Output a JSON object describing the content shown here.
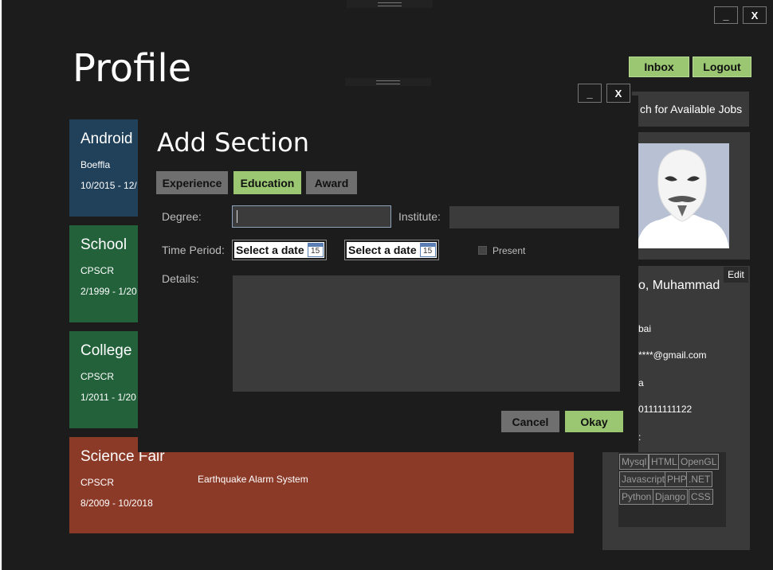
{
  "window": {
    "minimize_label": "_",
    "close_label": "X"
  },
  "page": {
    "title": "Profile"
  },
  "header": {
    "inbox_label": "Inbox",
    "logout_label": "Logout",
    "search_jobs_label": "ch for Available Jobs"
  },
  "sections": [
    {
      "title": "Android",
      "org": "Boeffla",
      "period": "10/2015 - 12/"
    },
    {
      "title": "School",
      "org": "CPSCR",
      "period": "2/1999 - 1/20"
    },
    {
      "title": "College",
      "org": "CPSCR",
      "period": "1/2011 - 1/20"
    },
    {
      "title": "Science Fair",
      "org": "CPSCR",
      "period": "8/2009 - 10/2018",
      "description": "Earthquake Alarm System"
    }
  ],
  "profile": {
    "edit_label": "Edit",
    "name": "o, Muhammad",
    "city": "bai",
    "email": "****@gmail.com",
    "country": "a",
    "phone": "01111111122",
    "skills_label": ":",
    "skills": [
      "Mysql",
      "HTML",
      "OpenGL",
      "Javascript",
      "PHP",
      ".NET",
      "Python",
      "Django",
      "CSS"
    ]
  },
  "dialog": {
    "minimize_label": "_",
    "close_label": "X",
    "title": "Add Section",
    "tabs": [
      "Experience",
      "Education",
      "Award"
    ],
    "active_tab": "Education",
    "degree_label": "Degree:",
    "degree_value": "",
    "institute_label": "Institute:",
    "institute_value": "",
    "time_period_label": "Time Period:",
    "start_date_placeholder": "Select a date",
    "end_date_placeholder": "Select a date",
    "calendar_day": "15",
    "present_label": "Present",
    "present_checked": false,
    "details_label": "Details:",
    "details_value": "",
    "cancel_label": "Cancel",
    "okay_label": "Okay"
  },
  "colors": {
    "background": "#1c1c1c",
    "accent_green": "#9bc773",
    "card_blue": "#21415a",
    "card_green": "#22613a",
    "card_red": "#8c3a28",
    "panel_gray": "#3a3a3a"
  }
}
